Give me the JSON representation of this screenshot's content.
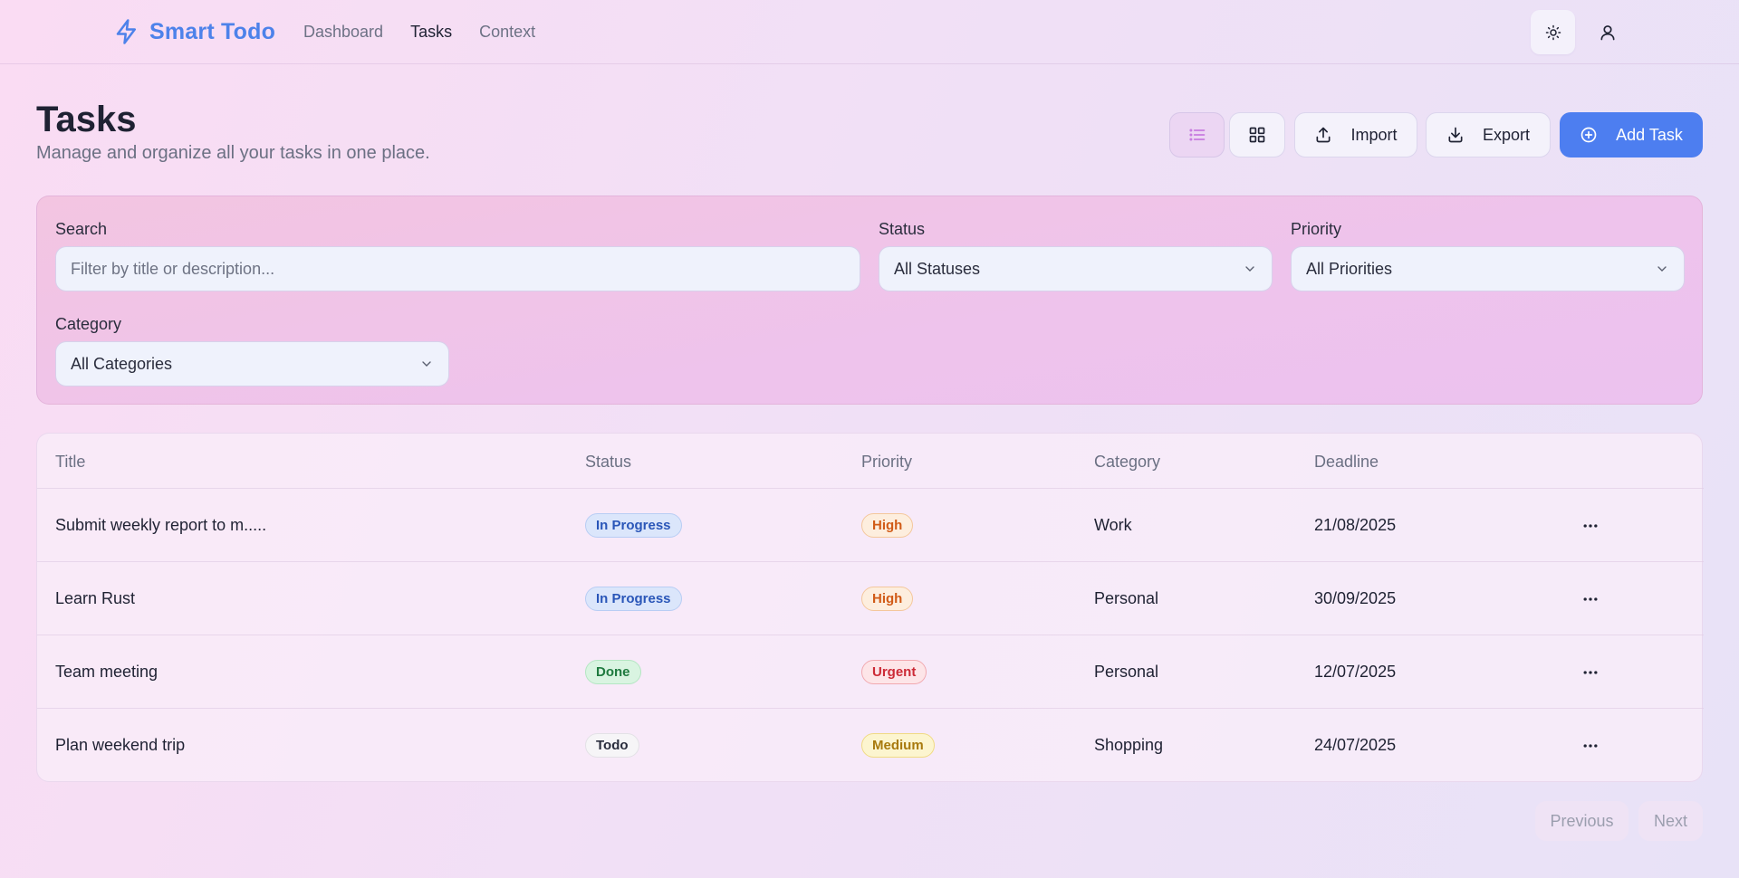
{
  "app": {
    "name": "Smart Todo"
  },
  "nav": [
    "Dashboard",
    "Tasks",
    "Context"
  ],
  "nav_active": "Tasks",
  "header": {
    "title": "Tasks",
    "subtitle": "Manage and organize all your tasks in one place."
  },
  "toolbar": {
    "view_list_icon": "list-icon",
    "view_grid_icon": "grid-icon",
    "import_label": "Import",
    "export_label": "Export",
    "add_label": "Add Task"
  },
  "filters": {
    "search": {
      "label": "Search",
      "placeholder": "Filter by title or description...",
      "value": ""
    },
    "status": {
      "label": "Status",
      "value": "All Statuses"
    },
    "priority": {
      "label": "Priority",
      "value": "All Priorities"
    },
    "category": {
      "label": "Category",
      "value": "All Categories"
    }
  },
  "table": {
    "columns": [
      "Title",
      "Status",
      "Priority",
      "Category",
      "Deadline"
    ],
    "rows": [
      {
        "title": "Submit weekly report to m.....",
        "status": "In Progress",
        "priority": "High",
        "category": "Work",
        "deadline": "21/08/2025"
      },
      {
        "title": "Learn Rust",
        "status": "In Progress",
        "priority": "High",
        "category": "Personal",
        "deadline": "30/09/2025"
      },
      {
        "title": "Team meeting",
        "status": "Done",
        "priority": "Urgent",
        "category": "Personal",
        "deadline": "12/07/2025"
      },
      {
        "title": "Plan weekend trip",
        "status": "Todo",
        "priority": "Medium",
        "category": "Shopping",
        "deadline": "24/07/2025"
      }
    ]
  },
  "pagination": {
    "previous": "Previous",
    "next": "Next"
  },
  "colors": {
    "accent": "#4d7ef0",
    "brand": "#4d82ea",
    "status_in_progress": "#2a56b8",
    "status_done": "#1f7a3f",
    "priority_high": "#d15b17",
    "priority_urgent": "#cc2a36",
    "priority_medium": "#a87a0d"
  }
}
